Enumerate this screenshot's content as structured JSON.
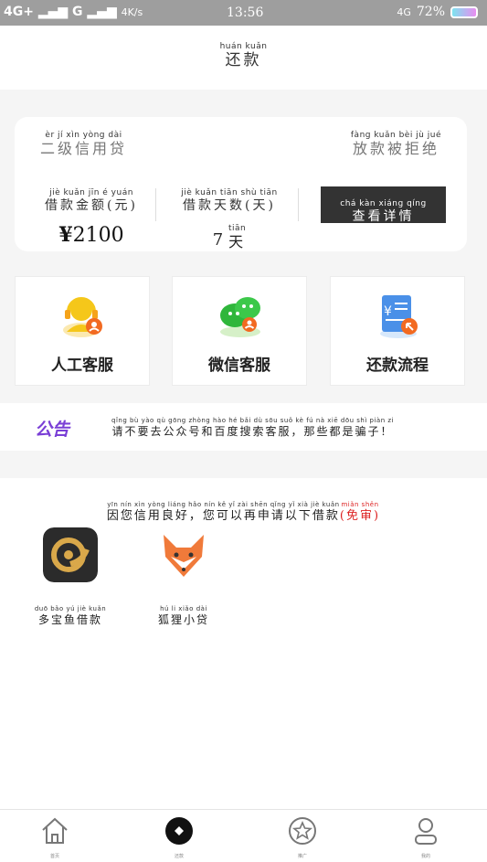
{
  "status_bar": {
    "network_left": "4G+",
    "network_mid": "G",
    "speed": "4K/s",
    "time": "13:56",
    "network_right": "4G",
    "battery": "72%"
  },
  "header": {
    "title_pinyin": "huán kuǎn",
    "title": "还款"
  },
  "loan_card": {
    "level_pinyin": "èr jí xìn yòng dài",
    "level": "二级信用贷",
    "status_pinyin": "fàng kuǎn bèi jù jué",
    "status": "放款被拒绝",
    "amount_label_pinyin": "jiè kuǎn jīn é yuán",
    "amount_label": "借款金额(元)",
    "amount_currency": "¥",
    "amount_value": "2100",
    "days_label_pinyin": "jiè kuǎn tiān shù tiān",
    "days_label": "借款天数(天)",
    "days_value": "7",
    "days_unit_pinyin": "tiān",
    "days_unit": "天",
    "detail_button_pinyin": "chá kàn xiáng qíng",
    "detail_button": "查看详情"
  },
  "services": [
    {
      "label": "人工客服",
      "icon": "customer-service-icon"
    },
    {
      "label": "微信客服",
      "icon": "wechat-icon"
    },
    {
      "label": "还款流程",
      "icon": "repay-process-icon"
    }
  ],
  "notice": {
    "badge": "公告",
    "text_pinyin": "qǐng bù yào qù gōng zhòng hào hé bǎi dù sōu suǒ kè fú nà xiē dōu shì piàn zi",
    "text": "请不要去公众号和百度搜索客服，那些都是骗子！"
  },
  "recommend": {
    "head_pinyin": "yīn nín xìn yòng liáng hǎo nín kě yǐ zài shēn qǐng yǐ xià jiè kuǎn",
    "head": "因您信用良好，您可以再申请以下借款",
    "head_tag_pinyin": "miǎn shěn",
    "head_tag": "(免审)",
    "apps": [
      {
        "name_pinyin": "duō bǎo yú jiè kuǎn",
        "name": "多宝鱼借款"
      },
      {
        "name_pinyin": "hú li xiǎo dài",
        "name": "狐狸小贷"
      }
    ]
  },
  "bottom_nav": [
    {
      "label": "首页",
      "icon": "home-icon"
    },
    {
      "label": "还款",
      "icon": "repay-icon",
      "active": true
    },
    {
      "label": "推广",
      "icon": "star-icon"
    },
    {
      "label": "我的",
      "icon": "profile-icon"
    }
  ],
  "colors": {
    "status_bar": "#9e9e9e",
    "detail_button": "#333333",
    "notice_badge": "#7a3fd6",
    "tag_red": "#dd2222"
  }
}
